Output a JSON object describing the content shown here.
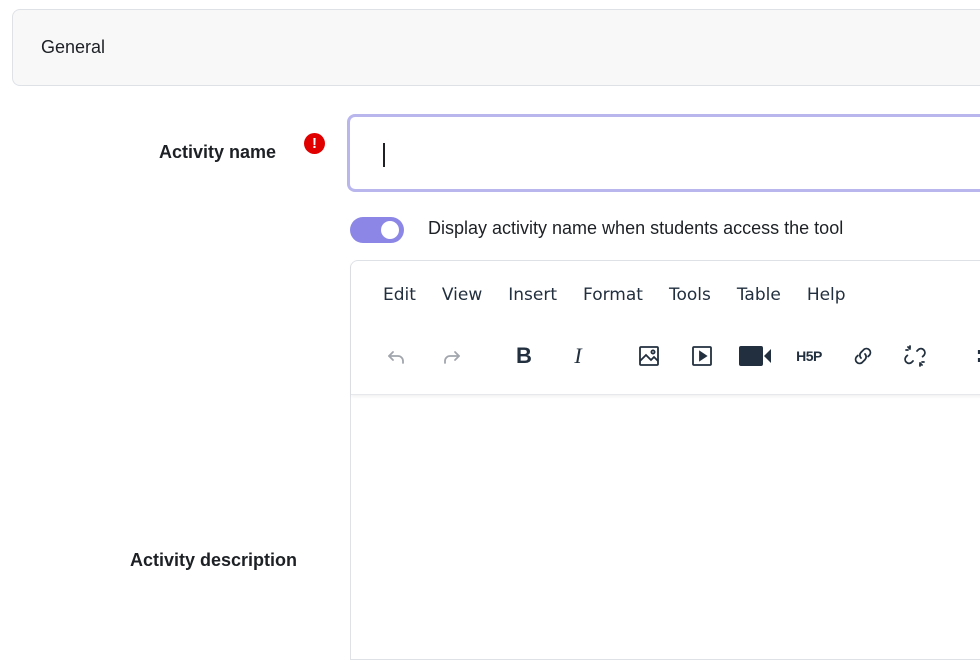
{
  "section": {
    "title": "General"
  },
  "name_field": {
    "label": "Activity name",
    "required_icon": "exclamation-circle-icon",
    "value": ""
  },
  "toggle": {
    "label": "Display activity name when students access the tool",
    "checked": true
  },
  "editor": {
    "menu": [
      "Edit",
      "View",
      "Insert",
      "Format",
      "Tools",
      "Table",
      "Help"
    ],
    "toolbar": [
      "undo-icon",
      "redo-icon",
      "bold-icon",
      "italic-icon",
      "image-icon",
      "media-icon",
      "video-record-icon",
      "h5p-icon",
      "link-icon",
      "unlink-icon"
    ],
    "h5p_text": "H5P",
    "bold_text": "B",
    "italic_text": "I"
  },
  "description_field": {
    "label": "Activity description"
  },
  "colors": {
    "accent": "#8c87e6",
    "input_border": "#b9b6ee",
    "required": "#e00000"
  }
}
